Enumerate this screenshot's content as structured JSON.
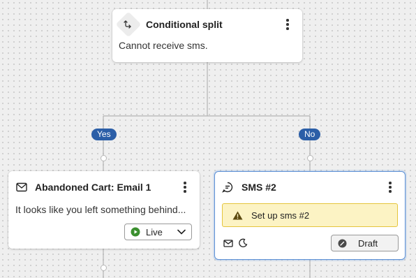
{
  "split_card": {
    "title": "Conditional split",
    "description": "Cannot receive sms."
  },
  "branches": {
    "yes_label": "Yes",
    "no_label": "No"
  },
  "email_card": {
    "title": "Abandoned Cart: Email 1",
    "description": "It looks like you left something behind...",
    "status": "Live",
    "status_color": "#3a8f2e"
  },
  "sms_card": {
    "title": "SMS #2",
    "warning_text": "Set up sms #2",
    "status": "Draft",
    "accent_color": "#5a8fd6"
  },
  "icons": [
    "split-icon",
    "kebab-menu-icon",
    "envelope-icon",
    "chat-bubble-icon",
    "warning-icon",
    "play-circle-icon",
    "chevron-down-icon",
    "message-icon",
    "moon-icon",
    "draft-icon"
  ]
}
